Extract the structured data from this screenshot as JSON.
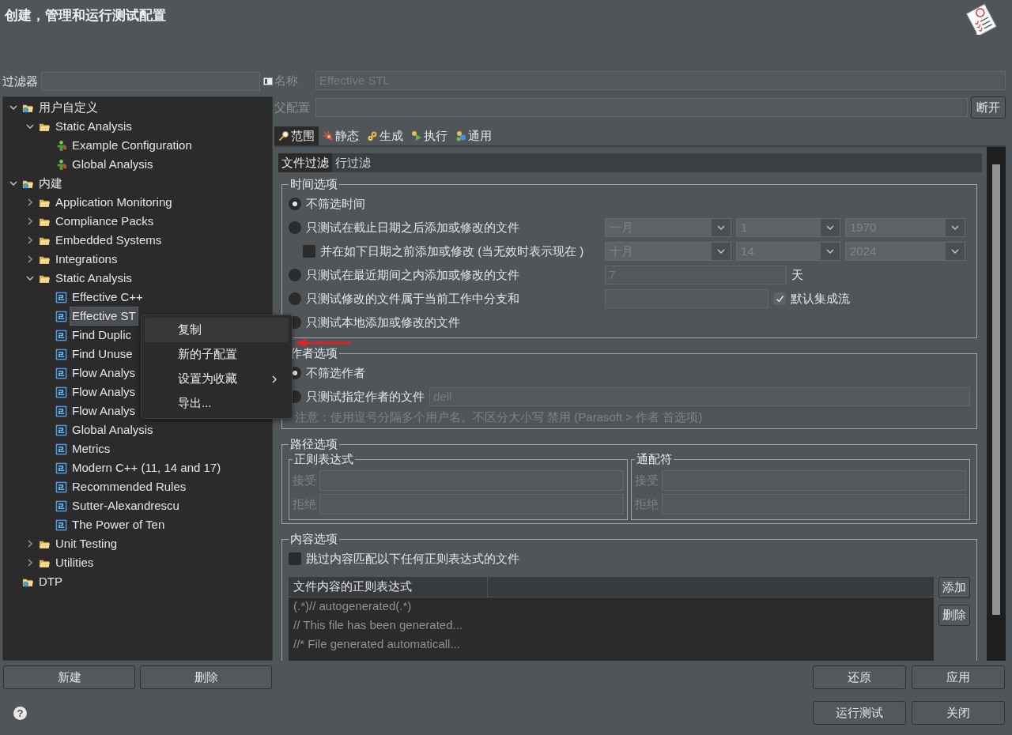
{
  "window": {
    "title": "创建，管理和运行测试配置"
  },
  "filter": {
    "label": "过滤器"
  },
  "tree": [
    {
      "label": "用户自定义",
      "kind": "root",
      "expanded": true,
      "selected": false,
      "children": [
        {
          "label": "Static Analysis",
          "kind": "folder",
          "expanded": true,
          "selected": false,
          "children": [
            {
              "label": "Example Configuration",
              "kind": "user",
              "selected": false
            },
            {
              "label": "Global Analysis",
              "kind": "user",
              "selected": false
            }
          ]
        }
      ]
    },
    {
      "label": "内建",
      "kind": "root",
      "expanded": true,
      "selected": false,
      "children": [
        {
          "label": "Application Monitoring",
          "kind": "folder",
          "expanded": false,
          "selected": false
        },
        {
          "label": "Compliance Packs",
          "kind": "folder",
          "expanded": false,
          "selected": false
        },
        {
          "label": "Embedded Systems",
          "kind": "folder",
          "expanded": false,
          "selected": false
        },
        {
          "label": "Integrations",
          "kind": "folder",
          "expanded": false,
          "selected": false
        },
        {
          "label": "Static Analysis",
          "kind": "folder",
          "expanded": true,
          "selected": false,
          "children": [
            {
              "label": "Effective C++",
              "kind": "builtin",
              "selected": false
            },
            {
              "label": "Effective ST",
              "kind": "builtin",
              "selected": true
            },
            {
              "label": "Find Duplic",
              "kind": "builtin",
              "selected": false
            },
            {
              "label": "Find Unuse",
              "kind": "builtin",
              "selected": false
            },
            {
              "label": "Flow Analys",
              "kind": "builtin",
              "selected": false
            },
            {
              "label": "Flow Analys",
              "kind": "builtin",
              "selected": false
            },
            {
              "label": "Flow Analys",
              "kind": "builtin",
              "selected": false
            },
            {
              "label": "Global Analysis",
              "kind": "builtin",
              "selected": false
            },
            {
              "label": "Metrics",
              "kind": "builtin",
              "selected": false
            },
            {
              "label": "Modern C++ (11, 14 and 17)",
              "kind": "builtin",
              "selected": false
            },
            {
              "label": "Recommended Rules",
              "kind": "builtin",
              "selected": false
            },
            {
              "label": "Sutter-Alexandrescu",
              "kind": "builtin",
              "selected": false
            },
            {
              "label": "The Power of Ten",
              "kind": "builtin",
              "selected": false
            }
          ]
        },
        {
          "label": "Unit Testing",
          "kind": "folder",
          "expanded": false,
          "selected": false
        },
        {
          "label": "Utilities",
          "kind": "folder",
          "expanded": false,
          "selected": false
        }
      ]
    },
    {
      "label": "DTP",
      "kind": "root",
      "selected": false
    }
  ],
  "left_buttons": [
    "新建",
    "删除"
  ],
  "context_menu": [
    {
      "label": "复制",
      "selected": true,
      "submenu": false
    },
    {
      "label": "新的子配置",
      "selected": false,
      "submenu": false
    },
    {
      "label": "设置为收藏",
      "selected": false,
      "submenu": true
    },
    {
      "label": "导出...",
      "selected": false,
      "submenu": false
    }
  ],
  "name_field": {
    "label": "名称",
    "value": "Effective STL"
  },
  "parent_field": {
    "label": "父配置",
    "button": "断开"
  },
  "tabs": [
    {
      "label": "范围",
      "selected": true
    },
    {
      "label": "静态",
      "selected": false
    },
    {
      "label": "生成",
      "selected": false
    },
    {
      "label": "执行",
      "selected": false
    },
    {
      "label": "通用",
      "selected": false
    }
  ],
  "subtabs": [
    {
      "label": "文件过滤",
      "selected": true
    },
    {
      "label": "行过滤",
      "selected": false
    }
  ],
  "time_options": {
    "title": "时间选项",
    "options": [
      {
        "kind": "radio",
        "label": "不筛选时间",
        "selected": true
      },
      {
        "kind": "radio",
        "label": "只测试在截止日期之后添加或修改的文件",
        "selected": false,
        "dates": [
          "一月",
          "1",
          "1970"
        ]
      },
      {
        "kind": "checkbox",
        "label": "并在如下日期之前添加或修改 (当无效时表示现在 )",
        "checked": false,
        "dates": [
          "十月",
          "14",
          "2024"
        ]
      },
      {
        "kind": "radio",
        "label": "只测试在最近期间之内添加或修改的文件",
        "selected": false,
        "field": "7",
        "suffix": "天"
      },
      {
        "kind": "radio",
        "label": "只测试修改的文件属于当前工作中分支和",
        "selected": false,
        "option": {
          "label": "默认集成流",
          "checked": true
        }
      },
      {
        "kind": "radio",
        "label": "只测试本地添加或修改的文件",
        "selected": false
      }
    ]
  },
  "author_options": {
    "title": "作者选项",
    "options": [
      {
        "kind": "radio",
        "label": "不筛选作者",
        "selected": true
      },
      {
        "kind": "radio",
        "label": "只测试指定作者的文件",
        "selected": false,
        "field": "dell"
      }
    ],
    "note": "注意：使用逗号分隔多个用户名。不区分大小写 禁用 (Parasoft > 作者 首选项)"
  },
  "path_options": {
    "title": "路径选项",
    "groups": [
      {
        "title": "正则表达式",
        "fields": [
          "接受",
          "拒绝"
        ]
      },
      {
        "title": "通配符",
        "fields": [
          "接受",
          "拒绝"
        ]
      }
    ]
  },
  "content_options": {
    "title": "内容选项",
    "checkbox": {
      "label": "跳过内容匹配以下任何正则表达式的文件",
      "checked": false
    },
    "table": {
      "columns": [
        "文件内容的正则表达式"
      ],
      "rows": [
        "(.*)// autogenerated(.*)",
        "// This file has been generated...",
        "//* File generated automaticall..."
      ]
    },
    "buttons": [
      "添加",
      "删除"
    ]
  },
  "bottom_buttons": [
    [
      "还原",
      "应用"
    ],
    [
      "运行测试",
      "关闭"
    ]
  ],
  "help": "?"
}
